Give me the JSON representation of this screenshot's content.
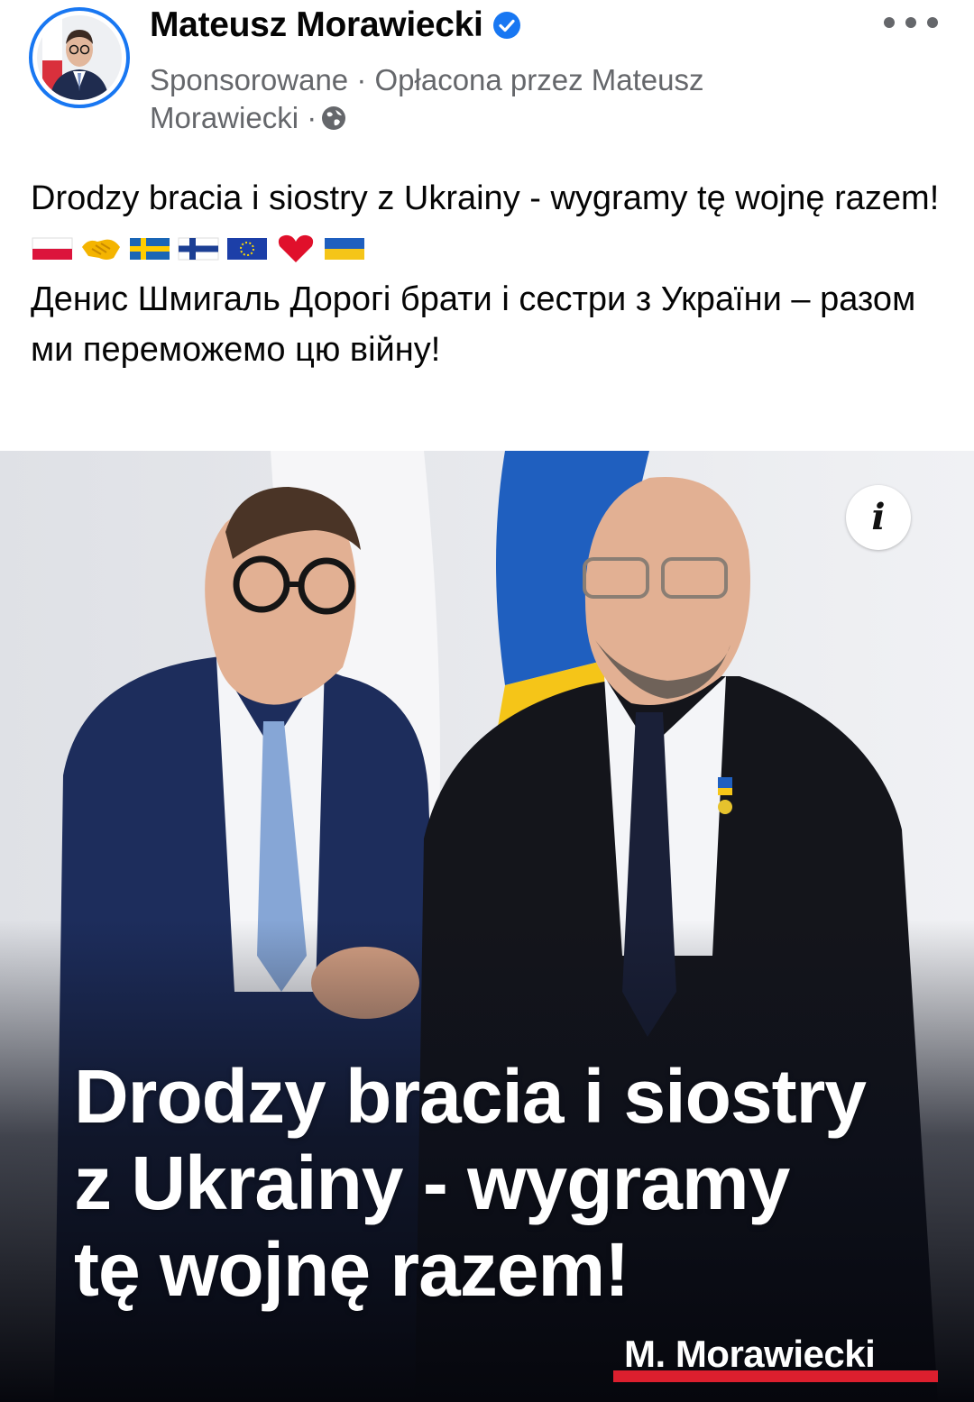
{
  "post": {
    "author": "Mateusz Morawiecki",
    "sponsored_text": "Sponsorowane · Opłacona przez Mateusz",
    "sponsored_text_line2": "Morawiecki ·",
    "body_line_pl": "Drodzy bracia i siostry z Ukrainy - wygramy tę wojnę razem!",
    "emoji_icons": [
      "poland-flag-icon",
      "handshake-icon",
      "sweden-flag-icon",
      "finland-flag-icon",
      "eu-flag-icon",
      "red-heart-icon",
      "ukraine-flag-icon"
    ],
    "body_line_uk": "Денис Шмигаль Дорогі брати і сестри з України – разом ми переможемо цю війну!"
  },
  "image": {
    "headline_lines": [
      "Drodzy bracia i siostry",
      "z Ukrainy - wygramy",
      "tę wojnę razem!"
    ],
    "signature": "M. Morawiecki",
    "info_glyph": "i"
  },
  "colors": {
    "verified_blue": "#1877f2",
    "signature_red": "#dc1f2e",
    "ukraine_blue": "#1f5fbf",
    "ukraine_yellow": "#f5c518",
    "suit_navy": "#1d2d5c"
  }
}
